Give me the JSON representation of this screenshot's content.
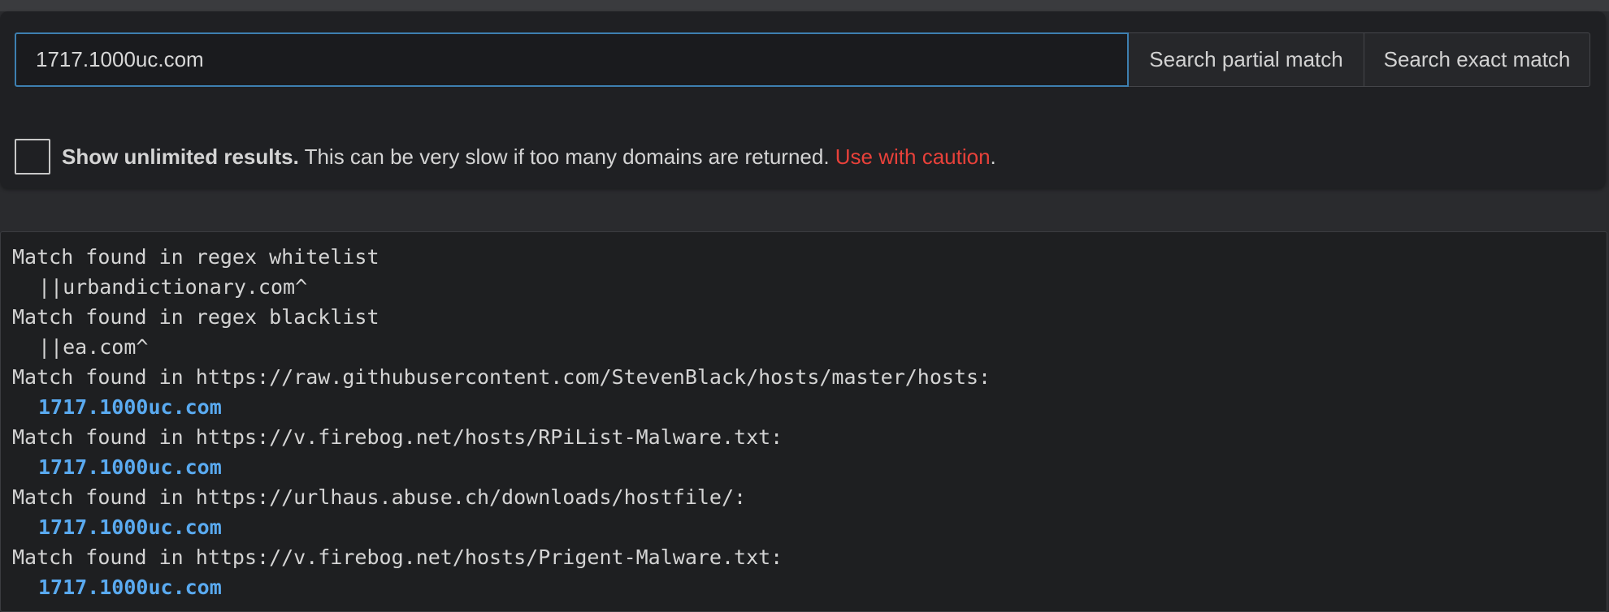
{
  "search": {
    "input_value": "1717.1000uc.com",
    "partial_label": "Search partial match",
    "exact_label": "Search exact match"
  },
  "options": {
    "unlimited_bold": "Show unlimited results.",
    "unlimited_text": " This can be very slow if too many domains are returned. ",
    "caution_text": "Use with caution",
    "trailing": ".",
    "caution_color": "#e8413a"
  },
  "results": {
    "lines": [
      "Match found in regex whitelist",
      "||urbandictionary.com^",
      "Match found in regex blacklist",
      "||ea.com^",
      "Match found in https://raw.githubusercontent.com/StevenBlack/hosts/master/hosts:",
      "1717.1000uc.com",
      "Match found in https://v.firebog.net/hosts/RPiList-Malware.txt:",
      "1717.1000uc.com",
      "Match found in https://urlhaus.abuse.ch/downloads/hostfile/:",
      "1717.1000uc.com",
      "Match found in https://v.firebog.net/hosts/Prigent-Malware.txt:",
      "1717.1000uc.com"
    ],
    "highlight_color": "#5aaaf0"
  }
}
